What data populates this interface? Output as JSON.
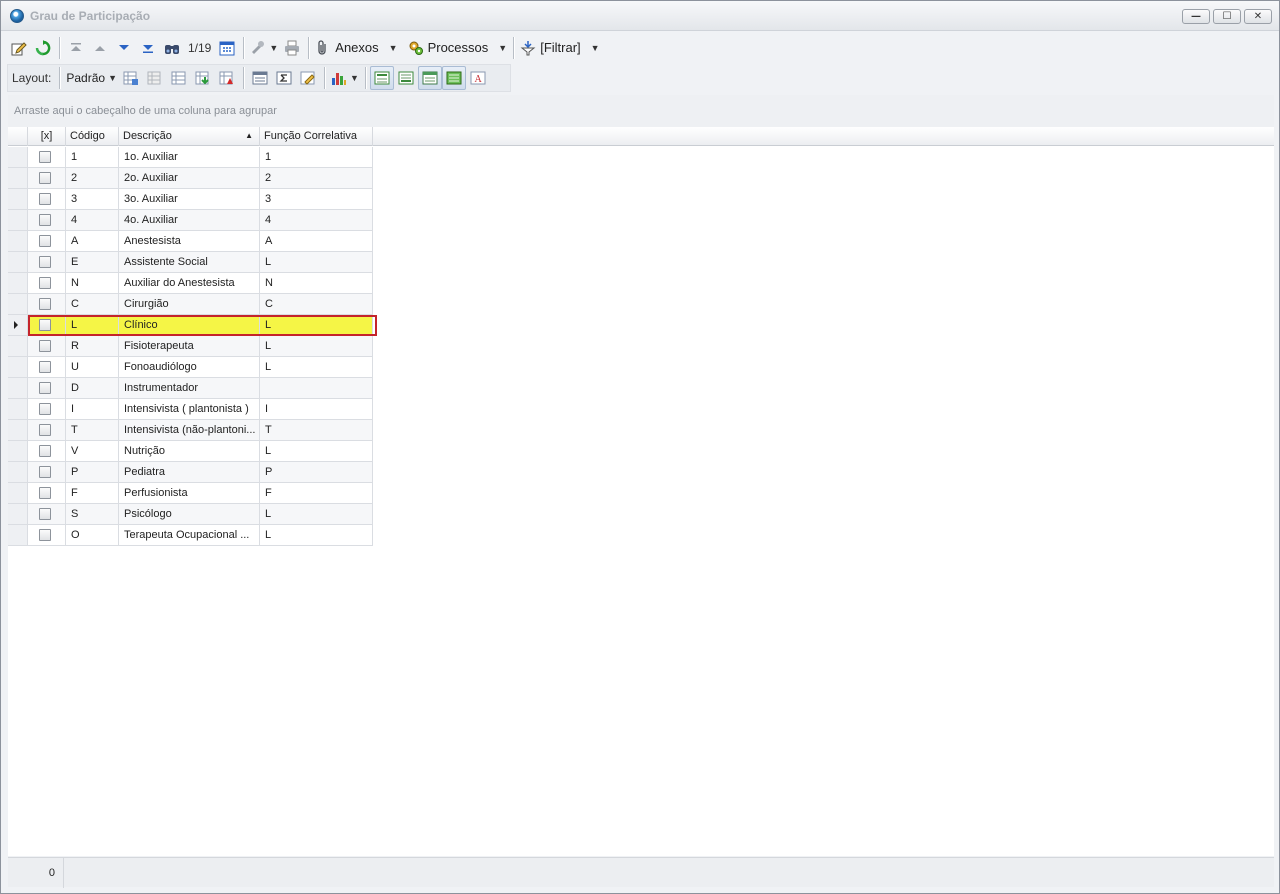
{
  "window": {
    "title": "Grau de Participação",
    "controls": {
      "minimize": "—",
      "maximize": "☐",
      "close": "✕"
    }
  },
  "toolbar": {
    "record_position": "1/19",
    "anexos_label": "Anexos",
    "processos_label": "Processos",
    "filtrar_label": "[Filtrar]"
  },
  "layout_toolbar": {
    "layout_label": "Layout:",
    "layout_value": "Padrão"
  },
  "group_panel": {
    "hint": "Arraste aqui o cabeçalho de uma coluna para agrupar"
  },
  "grid": {
    "columns": {
      "select": "[x]",
      "codigo": "Código",
      "descricao": "Descrição",
      "funcao": "Função Correlativa"
    },
    "sorted_column": "Descrição",
    "selected_index": 8,
    "rows": [
      {
        "codigo": "1",
        "descricao": "1o. Auxiliar",
        "funcao": "1"
      },
      {
        "codigo": "2",
        "descricao": "2o. Auxiliar",
        "funcao": "2"
      },
      {
        "codigo": "3",
        "descricao": "3o. Auxiliar",
        "funcao": "3"
      },
      {
        "codigo": "4",
        "descricao": "4o. Auxiliar",
        "funcao": "4"
      },
      {
        "codigo": "A",
        "descricao": "Anestesista",
        "funcao": "A"
      },
      {
        "codigo": "E",
        "descricao": "Assistente Social",
        "funcao": "L"
      },
      {
        "codigo": "N",
        "descricao": "Auxiliar do Anestesista",
        "funcao": "N"
      },
      {
        "codigo": "C",
        "descricao": "Cirurgião",
        "funcao": "C"
      },
      {
        "codigo": "L",
        "descricao": "Clínico",
        "funcao": "L"
      },
      {
        "codigo": "R",
        "descricao": "Fisioterapeuta",
        "funcao": "L"
      },
      {
        "codigo": "U",
        "descricao": "Fonoaudiólogo",
        "funcao": "L"
      },
      {
        "codigo": "D",
        "descricao": "Instrumentador",
        "funcao": ""
      },
      {
        "codigo": "I",
        "descricao": "Intensivista ( plantonista )",
        "funcao": "I"
      },
      {
        "codigo": "T",
        "descricao": "Intensivista (não-plantoni...",
        "funcao": "T"
      },
      {
        "codigo": "V",
        "descricao": "Nutrição",
        "funcao": "L"
      },
      {
        "codigo": "P",
        "descricao": "Pediatra",
        "funcao": "P"
      },
      {
        "codigo": "F",
        "descricao": "Perfusionista",
        "funcao": "F"
      },
      {
        "codigo": "S",
        "descricao": "Psicólogo",
        "funcao": "L"
      },
      {
        "codigo": "O",
        "descricao": "Terapeuta Ocupacional   ...",
        "funcao": "L"
      }
    ]
  },
  "status": {
    "count": "0"
  },
  "colors": {
    "selected_row": "#f5f546",
    "selected_border": "#c4242b"
  }
}
